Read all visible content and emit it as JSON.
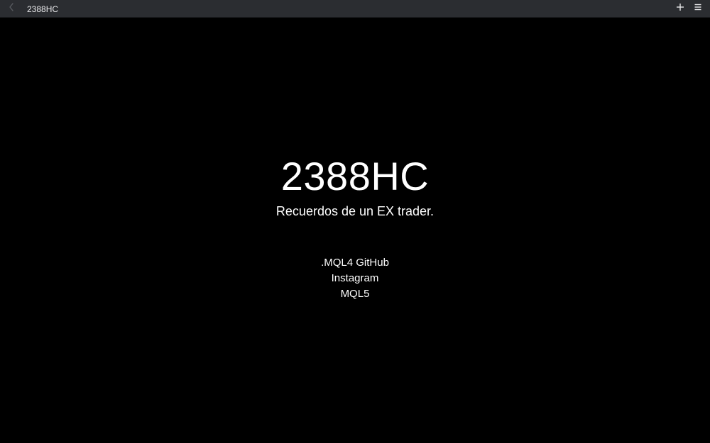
{
  "window": {
    "tab_title": "2388HC",
    "back_icon": "chevron-left-icon",
    "add_icon": "plus-icon",
    "menu_icon": "hamburger-menu-icon"
  },
  "page": {
    "title": "2388HC",
    "tagline": "Recuerdos de un EX trader.",
    "links": [
      {
        "label": ".MQL4 GitHub"
      },
      {
        "label": "Instagram"
      },
      {
        "label": "MQL5"
      }
    ]
  },
  "colors": {
    "background": "#000000",
    "titlebar": "#2b2d31",
    "text": "#ffffff",
    "disabled_icon": "#5a5c61"
  }
}
